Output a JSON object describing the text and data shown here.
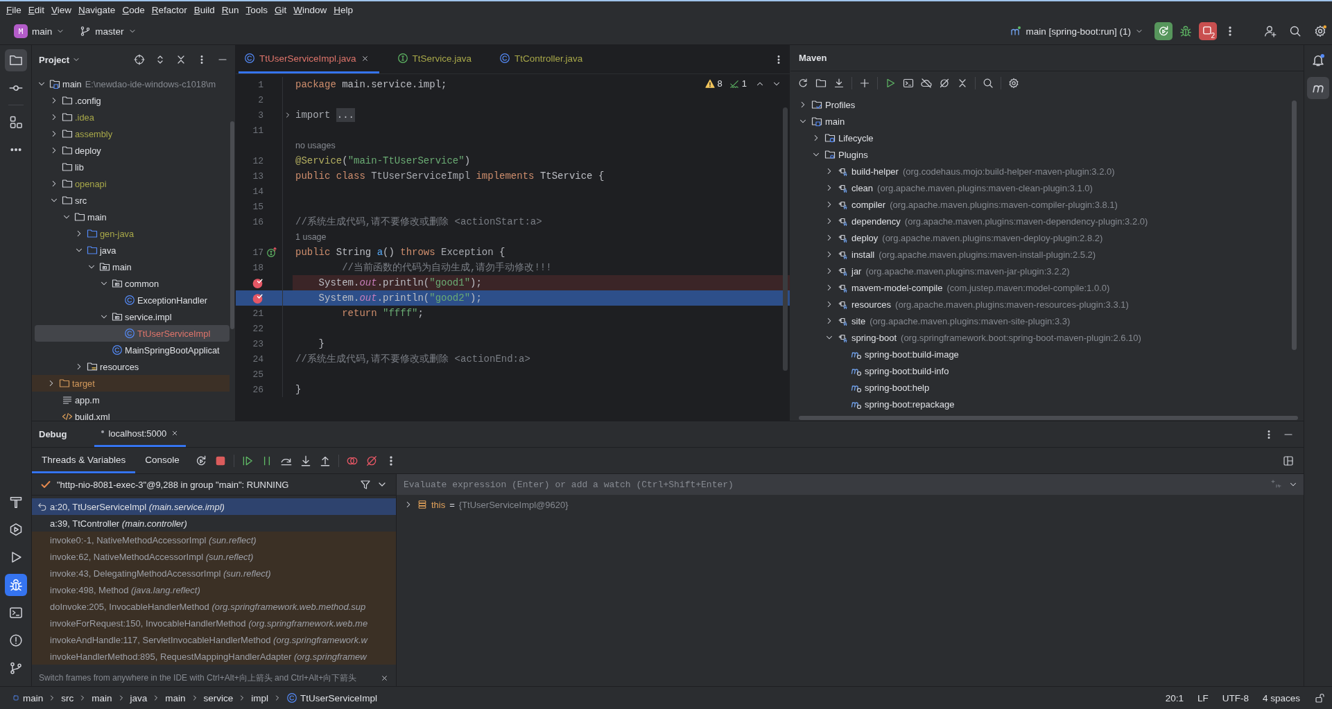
{
  "menu": [
    "File",
    "Edit",
    "View",
    "Navigate",
    "Code",
    "Refactor",
    "Build",
    "Run",
    "Tools",
    "Git",
    "Window",
    "Help"
  ],
  "toolbar": {
    "project": {
      "badge": "M",
      "name": "main"
    },
    "branch": "master",
    "run_configuration": "main [spring-boot:run] (1)",
    "stop_badge": "2"
  },
  "left_strip": {
    "top": [
      {
        "kind": "project",
        "selected": true
      },
      {
        "kind": "commit",
        "selected": false
      },
      {
        "kind": "structure",
        "selected": false
      },
      {
        "kind": "more",
        "selected": false
      }
    ],
    "bottom": [
      {
        "kind": "build",
        "selected": false
      },
      {
        "kind": "services",
        "selected": false
      },
      {
        "kind": "run",
        "selected": false
      },
      {
        "kind": "debug",
        "selected": true
      },
      {
        "kind": "terminal",
        "selected": false
      },
      {
        "kind": "problems",
        "selected": false
      },
      {
        "kind": "git",
        "selected": false
      }
    ]
  },
  "project": {
    "title": "Project",
    "tree": [
      {
        "label": "main",
        "path": "E:\\newdao-ide-windows-c1018\\m",
        "kind": "module",
        "expanded": true,
        "selected": false,
        "children": [
          {
            "label": ".config",
            "kind": "folder",
            "expanded": false,
            "selected": false
          },
          {
            "label": ".idea",
            "kind": "folder",
            "color": "#a8a849",
            "expanded": false,
            "selected": false
          },
          {
            "label": "assembly",
            "kind": "folder",
            "color": "#a8a849",
            "expanded": false,
            "selected": false
          },
          {
            "label": "deploy",
            "kind": "folder",
            "expanded": false,
            "selected": false
          },
          {
            "label": "lib",
            "kind": "folder",
            "selected": false
          },
          {
            "label": "openapi",
            "kind": "folder",
            "color": "#a8a849",
            "expanded": false,
            "selected": false
          },
          {
            "label": "src",
            "kind": "folder",
            "expanded": true,
            "selected": false,
            "children": [
              {
                "label": "main",
                "kind": "folder",
                "expanded": true,
                "selected": false,
                "children": [
                  {
                    "label": "gen-java",
                    "kind": "source-root",
                    "color": "#a8a849",
                    "expanded": false,
                    "selected": false
                  },
                  {
                    "label": "java",
                    "kind": "source-root",
                    "expanded": true,
                    "selected": false,
                    "children": [
                      {
                        "label": "main",
                        "kind": "package",
                        "expanded": true,
                        "selected": false,
                        "children": [
                          {
                            "label": "common",
                            "kind": "package",
                            "expanded": true,
                            "selected": false,
                            "children": [
                              {
                                "label": "ExceptionHandler",
                                "kind": "class",
                                "selected": false
                              }
                            ]
                          },
                          {
                            "label": "service.impl",
                            "kind": "package",
                            "expanded": true,
                            "selected": false,
                            "children": [
                              {
                                "label": "TtUserServiceImpl",
                                "kind": "class",
                                "color": "#e0756b",
                                "selected": true
                              }
                            ]
                          },
                          {
                            "label": "MainSpringBootApplicat",
                            "kind": "class",
                            "selected": false
                          }
                        ]
                      }
                    ]
                  },
                  {
                    "label": "resources",
                    "kind": "resources-root",
                    "expanded": false,
                    "selected": false
                  }
                ]
              }
            ]
          },
          {
            "label": "target",
            "kind": "excluded-folder",
            "color": "#d49a5c",
            "expanded": false,
            "selected": false
          },
          {
            "label": "app.m",
            "kind": "text-file",
            "selected": false
          },
          {
            "label": "build.xml",
            "kind": "xml-file",
            "selected": false
          }
        ]
      }
    ]
  },
  "editor": {
    "tabs": [
      {
        "label": "TtUserServiceImpl.java",
        "kind": "class",
        "color": "#e0756b",
        "selected": true
      },
      {
        "label": "TtService.java",
        "kind": "interface",
        "color": "#a8a849",
        "selected": false
      },
      {
        "label": "TtController.java",
        "kind": "class",
        "color": "#a8a849",
        "selected": false
      }
    ],
    "inspections": {
      "warnings": "8",
      "passed": "1"
    },
    "lines": [
      {
        "kind": "code",
        "number": "1",
        "breakpoint": false,
        "current": false,
        "parts": [
          {
            "kind": "keyword",
            "text": "package"
          },
          {
            "kind": "plain",
            "text": " main.service.impl;"
          }
        ]
      },
      {
        "kind": "code",
        "number": "2",
        "breakpoint": false,
        "current": false
      },
      {
        "kind": "code",
        "number": "3",
        "breakpoint": false,
        "current": false,
        "folded": true,
        "parts": [
          {
            "kind": "dim",
            "text": "import "
          },
          {
            "kind": "folded",
            "text": "..."
          }
        ]
      },
      {
        "kind": "code",
        "number": "11",
        "breakpoint": false,
        "current": false
      },
      {
        "kind": "hint",
        "text": "no usages"
      },
      {
        "kind": "code",
        "number": "12",
        "breakpoint": false,
        "current": false,
        "parts": [
          {
            "kind": "annotation",
            "text": "@Service"
          },
          {
            "kind": "plain",
            "text": "("
          },
          {
            "kind": "string",
            "text": "\"main-TtUserService\""
          },
          {
            "kind": "plain",
            "text": ")"
          }
        ]
      },
      {
        "kind": "code",
        "number": "13",
        "breakpoint": false,
        "current": false,
        "parts": [
          {
            "kind": "keyword",
            "text": "public class "
          },
          {
            "kind": "dim",
            "text": "TtUserServiceImpl "
          },
          {
            "kind": "keyword",
            "text": "implements "
          },
          {
            "kind": "plain",
            "text": "TtService {"
          }
        ]
      },
      {
        "kind": "code",
        "number": "14",
        "breakpoint": false,
        "current": false
      },
      {
        "kind": "code",
        "number": "15",
        "breakpoint": false,
        "current": false
      },
      {
        "kind": "code",
        "number": "16",
        "breakpoint": false,
        "current": false,
        "parts": [
          {
            "kind": "comment",
            "text": "//系统生成代码,请不要修改或删除 <actionStart:a>"
          }
        ]
      },
      {
        "kind": "hint",
        "text": "1 usage"
      },
      {
        "kind": "code",
        "number": "17",
        "breakpoint": false,
        "current": false,
        "implements": true,
        "parts": [
          {
            "kind": "keyword",
            "text": "public "
          },
          {
            "kind": "plain",
            "text": "String "
          },
          {
            "kind": "method",
            "text": "a"
          },
          {
            "kind": "plain",
            "text": "() "
          },
          {
            "kind": "keyword",
            "text": "throws "
          },
          {
            "kind": "dim",
            "text": "Exception "
          },
          {
            "kind": "plain",
            "text": "{"
          }
        ]
      },
      {
        "kind": "code",
        "number": "18",
        "breakpoint": false,
        "current": false,
        "parts": [
          {
            "kind": "comment",
            "text": "        //当前函数的代码为自动生成,请勿手动修改!!!"
          }
        ]
      },
      {
        "kind": "code",
        "breakpoint": true,
        "current": false,
        "parts": [
          {
            "kind": "plain",
            "text": "    System."
          },
          {
            "kind": "field",
            "text": "out"
          },
          {
            "kind": "plain",
            "text": ".println("
          },
          {
            "kind": "string",
            "text": "\"good1\""
          },
          {
            "kind": "plain",
            "text": ");"
          }
        ]
      },
      {
        "kind": "code",
        "breakpoint": true,
        "current": true,
        "parts": [
          {
            "kind": "plain",
            "text": "    System."
          },
          {
            "kind": "field",
            "text": "out"
          },
          {
            "kind": "plain",
            "text": ".println("
          },
          {
            "kind": "string",
            "text": "\"good2\""
          },
          {
            "kind": "plain",
            "text": ");"
          }
        ]
      },
      {
        "kind": "code",
        "number": "21",
        "breakpoint": false,
        "current": false,
        "parts": [
          {
            "kind": "keyword",
            "text": "        return "
          },
          {
            "kind": "string",
            "text": "\"ffff\""
          },
          {
            "kind": "plain",
            "text": ";"
          }
        ]
      },
      {
        "kind": "code",
        "number": "22",
        "breakpoint": false,
        "current": false
      },
      {
        "kind": "code",
        "number": "23",
        "breakpoint": false,
        "current": false,
        "parts": [
          {
            "kind": "plain",
            "text": "    }"
          }
        ]
      },
      {
        "kind": "code",
        "number": "24",
        "breakpoint": false,
        "current": false,
        "parts": [
          {
            "kind": "comment",
            "text": "//系统生成代码,请不要修改或删除 <actionEnd:a>"
          }
        ]
      },
      {
        "kind": "code",
        "number": "25",
        "breakpoint": false,
        "current": false
      },
      {
        "kind": "code",
        "number": "26",
        "breakpoint": false,
        "current": false,
        "parts": [
          {
            "kind": "plain",
            "text": "}"
          }
        ]
      }
    ]
  },
  "maven": {
    "title": "Maven",
    "tree": [
      {
        "label": "Profiles",
        "kind": "profiles",
        "expanded": false
      },
      {
        "label": "main",
        "kind": "module",
        "expanded": true,
        "children": [
          {
            "label": "Lifecycle",
            "kind": "lifecycle",
            "expanded": false
          },
          {
            "label": "Plugins",
            "kind": "plugins",
            "expanded": true,
            "children": [
              {
                "label": "build-helper",
                "detail": "(org.codehaus.mojo:build-helper-maven-plugin:3.2.0)",
                "kind": "plugin",
                "expanded": false
              },
              {
                "label": "clean",
                "detail": "(org.apache.maven.plugins:maven-clean-plugin:3.1.0)",
                "kind": "plugin",
                "expanded": false
              },
              {
                "label": "compiler",
                "detail": "(org.apache.maven.plugins:maven-compiler-plugin:3.8.1)",
                "kind": "plugin",
                "expanded": false
              },
              {
                "label": "dependency",
                "detail": "(org.apache.maven.plugins:maven-dependency-plugin:3.2.0)",
                "kind": "plugin",
                "expanded": false
              },
              {
                "label": "deploy",
                "detail": "(org.apache.maven.plugins:maven-deploy-plugin:2.8.2)",
                "kind": "plugin",
                "expanded": false
              },
              {
                "label": "install",
                "detail": "(org.apache.maven.plugins:maven-install-plugin:2.5.2)",
                "kind": "plugin",
                "expanded": false
              },
              {
                "label": "jar",
                "detail": "(org.apache.maven.plugins:maven-jar-plugin:3.2.2)",
                "kind": "plugin",
                "expanded": false
              },
              {
                "label": "mavem-model-compile",
                "detail": "(com.justep.maven:model-compile:1.0.0)",
                "kind": "plugin",
                "expanded": false
              },
              {
                "label": "resources",
                "detail": "(org.apache.maven.plugins:maven-resources-plugin:3.3.1)",
                "kind": "plugin",
                "expanded": false
              },
              {
                "label": "site",
                "detail": "(org.apache.maven.plugins:maven-site-plugin:3.3)",
                "kind": "plugin",
                "expanded": false
              },
              {
                "label": "spring-boot",
                "detail": "(org.springframework.boot:spring-boot-maven-plugin:2.6.10)",
                "kind": "plugin",
                "expanded": true,
                "children": [
                  {
                    "label": "spring-boot:build-image",
                    "kind": "goal"
                  },
                  {
                    "label": "spring-boot:build-info",
                    "kind": "goal"
                  },
                  {
                    "label": "spring-boot:help",
                    "kind": "goal"
                  },
                  {
                    "label": "spring-boot:repackage",
                    "kind": "goal"
                  }
                ]
              }
            ]
          }
        ]
      }
    ]
  },
  "right_strip": [
    {
      "kind": "notifications",
      "selected": false
    },
    {
      "kind": "maven",
      "selected": true
    }
  ],
  "debug": {
    "title": "Debug",
    "sessions": [
      {
        "label": "localhost:5000",
        "selected": true
      }
    ],
    "tabs": [
      {
        "label": "Threads & Variables",
        "selected": true
      },
      {
        "label": "Console",
        "selected": false
      }
    ],
    "thread": "\"http-nio-8081-exec-3\"@9,288 in group \"main\": RUNNING",
    "frames": [
      {
        "text": "a:20, TtUserServiceImpl *(main.service.impl)*",
        "library": false,
        "selected": true
      },
      {
        "text": "a:39, TtController *(main.controller)*",
        "library": false,
        "selected": false
      },
      {
        "text": "invoke0:-1, NativeMethodAccessorImpl *(sun.reflect)*",
        "library": true,
        "selected": false
      },
      {
        "text": "invoke:62, NativeMethodAccessorImpl *(sun.reflect)*",
        "library": true,
        "selected": false
      },
      {
        "text": "invoke:43, DelegatingMethodAccessorImpl *(sun.reflect)*",
        "library": true,
        "selected": false
      },
      {
        "text": "invoke:498, Method *(java.lang.reflect)*",
        "library": true,
        "selected": false
      },
      {
        "text": "doInvoke:205, InvocableHandlerMethod *(org.springframework.web.method.sup*",
        "library": true,
        "selected": false
      },
      {
        "text": "invokeForRequest:150, InvocableHandlerMethod *(org.springframework.web.me*",
        "library": true,
        "selected": false
      },
      {
        "text": "invokeAndHandle:117, ServletInvocableHandlerMethod *(org.springframework.w*",
        "library": true,
        "selected": false
      },
      {
        "text": "invokeHandlerMethod:895, RequestMappingHandlerAdapter *(org.springframew*",
        "library": true,
        "selected": false
      }
    ],
    "evaluate": {
      "placeholder": "Evaluate expression (Enter) or add a watch (Ctrl+Shift+Enter)"
    },
    "variables": [
      {
        "name": "this",
        "equals": "=",
        "value": "{TtUserServiceImpl@9620}",
        "expanded": false
      }
    ],
    "hint": "Switch frames from anywhere in the IDE with Ctrl+Alt+向上箭头 and Ctrl+Alt+向下箭头"
  },
  "status": {
    "breadcrumbs": [
      {
        "label": "main",
        "kind": "module"
      },
      {
        "label": "src",
        "kind": "directory"
      },
      {
        "label": "main",
        "kind": "directory"
      },
      {
        "label": "java",
        "kind": "directory"
      },
      {
        "label": "main",
        "kind": "directory"
      },
      {
        "label": "service",
        "kind": "directory"
      },
      {
        "label": "impl",
        "kind": "directory"
      },
      {
        "label": "TtUserServiceImpl",
        "kind": "class"
      }
    ],
    "position": "20:1",
    "line_separator": "LF",
    "encoding": "UTF-8",
    "indent": "4 spaces"
  }
}
